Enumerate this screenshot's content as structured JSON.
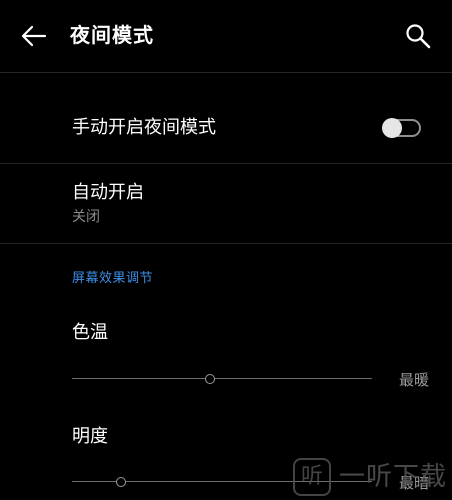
{
  "header": {
    "title": "夜间模式",
    "back_icon": "arrow-left-icon",
    "search_icon": "search-icon"
  },
  "manual": {
    "label": "手动开启夜间模式",
    "enabled": false
  },
  "auto": {
    "label": "自动开启",
    "status": "关闭"
  },
  "section": {
    "title": "屏幕效果调节"
  },
  "color_temp": {
    "label": "色温",
    "end_label": "最暖",
    "level": 0.46
  },
  "brightness": {
    "label": "明度",
    "end_label": "最暗",
    "level": 0.15
  },
  "watermark": {
    "glyph": "听",
    "text": "一听下载"
  },
  "colors": {
    "background": "#000000",
    "accent": "#3d8fe6",
    "secondary_text": "#8a8a8a",
    "divider": "#262626"
  }
}
